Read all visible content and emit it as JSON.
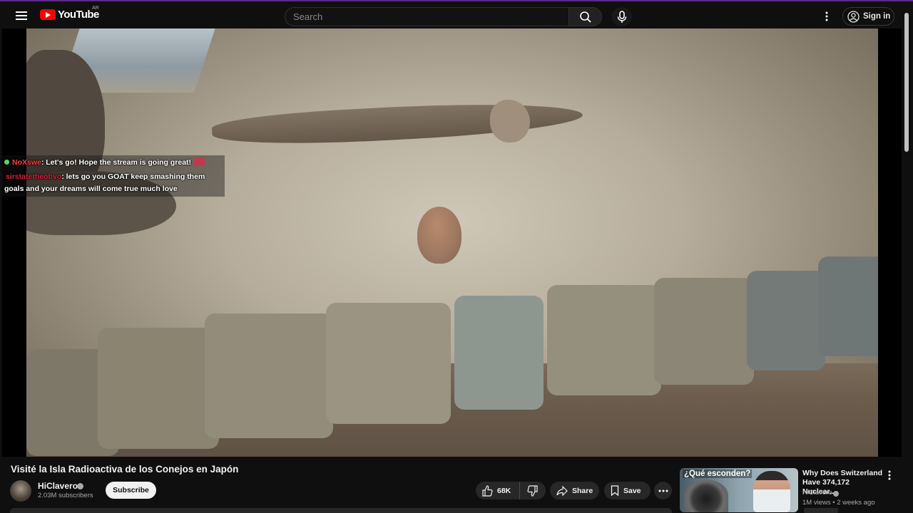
{
  "header": {
    "logo_text": "YouTube",
    "country_code": "AR",
    "search_placeholder": "Search",
    "signin_label": "Sign in",
    "icons": [
      "menu-icon",
      "search-icon",
      "mic-icon",
      "more-vert-icon",
      "account-icon"
    ]
  },
  "chat": {
    "messages": [
      {
        "user": "NoXswe",
        "text": ": Let's go! Hope the stream is going great!"
      },
      {
        "user": "sirstatetheobvo",
        "text": ": lets go you GOAT keep smashing them",
        "text_cont": "goals and your dreams will come true much love"
      }
    ],
    "colors": {
      "user1": "#ff3b3b",
      "user2": "#e01b3d",
      "online_dot": "#5cd65c"
    }
  },
  "video": {
    "title": "Visité la Isla Radioactiva de los Conejos en Japón"
  },
  "channel": {
    "name": "HiClavero",
    "subscribers": "2.03M subscribers",
    "subscribe_label": "Subscribe"
  },
  "actions": {
    "likes": "68K",
    "share_label": "Share",
    "save_label": "Save"
  },
  "recommendation": {
    "thumb_text": "¿Qué esconden?",
    "title": "Why Does Switzerland Have 374,172 Nuclear...",
    "channel": "HiClavero",
    "meta": "1M views • 2 weeks ago"
  },
  "colors": {
    "background": "#0f0f0f",
    "brand_red": "#ff0000",
    "pill": "#272727"
  }
}
